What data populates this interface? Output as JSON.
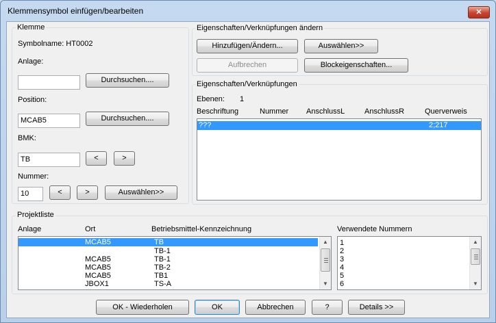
{
  "window": {
    "title": "Klemmensymbol einfügen/bearbeiten",
    "close_glyph": "✕"
  },
  "klemme": {
    "title": "Klemme",
    "symbolname": "Symbolname: HT0002",
    "anlage_label": "Anlage:",
    "anlage_value": "",
    "browse1": "Durchsuchen....",
    "position_label": "Position:",
    "position_value": "MCAB5",
    "browse2": "Durchsuchen....",
    "bmk_label": "BMK:",
    "bmk_value": "TB",
    "prev": "<",
    "next": ">",
    "nummer_label": "Nummer:",
    "nummer_value": "10",
    "prev2": "<",
    "next2": ">",
    "select": "Auswählen>>"
  },
  "edit": {
    "title": "Eigenschaften/Verknüpfungen ändern",
    "add_change": "Hinzufügen/Ändern...",
    "select": "Auswählen>>",
    "break": "Aufbrechen",
    "block_props": "Blockeigenschaften..."
  },
  "props": {
    "title": "Eigenschaften/Verknüpfungen",
    "ebenen_label": "Ebenen:",
    "ebenen_value": "1",
    "columns": [
      "Beschriftung",
      "Nummer",
      "AnschlussL",
      "AnschlussR",
      "Querverweis"
    ],
    "row": {
      "beschriftung": "???",
      "querverweis": "2;217"
    }
  },
  "projekt": {
    "title": "Projektliste",
    "col_anlage": "Anlage",
    "col_ort": "Ort",
    "col_bmk": "Betriebsmittel-Kennzeichnung",
    "col_nummern": "Verwendete Nummern",
    "rows": [
      {
        "anlage": "",
        "ort": "MCAB5",
        "bmk": "TB"
      },
      {
        "anlage": "",
        "ort": "",
        "bmk": "TB-1"
      },
      {
        "anlage": "",
        "ort": "MCAB5",
        "bmk": "TB-1"
      },
      {
        "anlage": "",
        "ort": "MCAB5",
        "bmk": "TB-2"
      },
      {
        "anlage": "",
        "ort": "MCAB5",
        "bmk": "TB1"
      },
      {
        "anlage": "",
        "ort": "JBOX1",
        "bmk": "TS-A"
      }
    ],
    "numbers": [
      "1",
      "2",
      "3",
      "4",
      "5",
      "6"
    ]
  },
  "footer": {
    "ok_repeat": "OK - Wiederholen",
    "ok": "OK",
    "cancel": "Abbrechen",
    "help": "?",
    "details": "Details >>"
  }
}
